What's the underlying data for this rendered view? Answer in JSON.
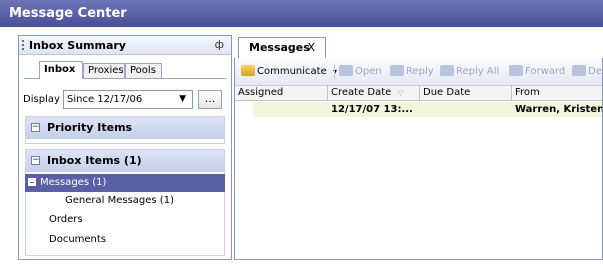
{
  "window": {
    "title": "Message Center"
  },
  "left_panel": {
    "title": "Inbox Summary",
    "pin_glyph": "ф",
    "tabs": [
      {
        "label": "Inbox",
        "active": true
      },
      {
        "label": "Proxies",
        "active": false
      },
      {
        "label": "Pools",
        "active": false
      }
    ],
    "display": {
      "label": "Display",
      "value": "Since  12/17/06",
      "browse_label": "..."
    },
    "priority_section": {
      "label": "Priority Items",
      "toggle": "−"
    },
    "inbox_section": {
      "label": "Inbox Items (1)",
      "toggle": "−",
      "items": [
        {
          "label": "Messages (1)",
          "selected": true
        },
        {
          "label": "General Messages (1)",
          "selected": false
        },
        {
          "label": "Orders",
          "selected": false
        },
        {
          "label": "Documents",
          "selected": false
        }
      ]
    }
  },
  "right_panel": {
    "tab": {
      "label": "Messages",
      "close": "X"
    },
    "toolbar": {
      "communicate": "Communicate",
      "communicate_arrow": "▾",
      "open": "Open",
      "reply": "Reply",
      "reply_all": "Reply All",
      "forward": "Forward",
      "delete": "Dele"
    },
    "columns": [
      "Assigned",
      "Create Date",
      "Due Date",
      "From"
    ],
    "sort_indicator": "▽",
    "rows": [
      {
        "assigned": "",
        "create_date": "12/17/07 13:...",
        "due_date": "",
        "from": "Warren, Kristen"
      }
    ]
  },
  "colors": {
    "title_bar": "#4f559b",
    "selected_row": "#5a60a6",
    "section_header": "#d0d8ef",
    "unread_row": "#f4f4dc"
  }
}
